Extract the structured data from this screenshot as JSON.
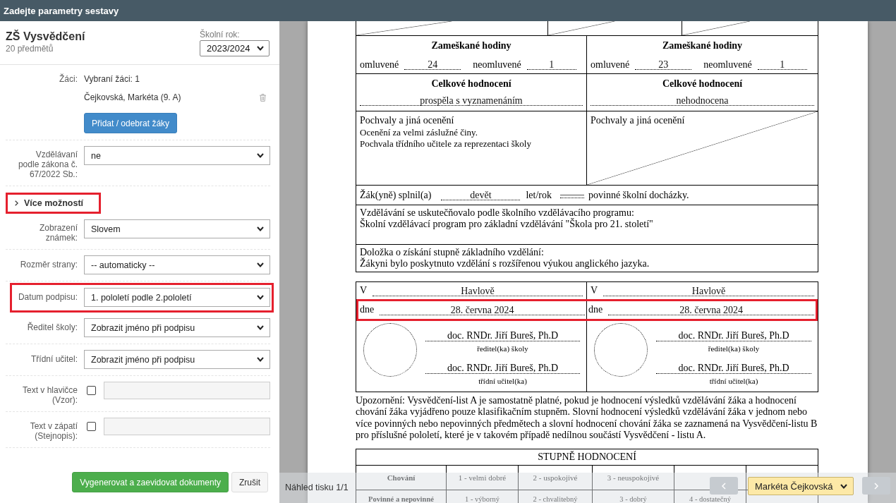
{
  "window": {
    "title": "Zadejte parametry sestavy"
  },
  "report": {
    "title": "ZŠ Vysvědčení",
    "subtitle": "20 předmětů",
    "school_year": {
      "label": "Školní rok:",
      "value": "2023/2024"
    }
  },
  "students": {
    "label": "Žáci:",
    "summary": "Vybraní žáci: 1",
    "items": [
      {
        "name": "Čejkovská, Markéta (9. A)"
      }
    ],
    "button": "Přidat / odebrat žáky"
  },
  "fields": [
    {
      "kind": "select",
      "label": "Vzdělávaní podle zákona č. 67/2022 Sb.:",
      "value": "ne",
      "highlighted": false
    },
    {
      "kind": "more_link",
      "label": "Více možností",
      "expanded": false,
      "highlighted": true
    },
    {
      "kind": "select",
      "label": "Zobrazení známek:",
      "value": "Slovem",
      "highlighted": false
    },
    {
      "kind": "select",
      "label": "Rozměr strany:",
      "value": "-- automaticky --",
      "highlighted": false
    },
    {
      "kind": "select",
      "label": "Datum podpisu:",
      "value": "1. pololetí podle 2.pololetí",
      "highlighted": true
    },
    {
      "kind": "select",
      "label": "Ředitel školy:",
      "value": "Zobrazit jméno při podpisu",
      "highlighted": false
    },
    {
      "kind": "select",
      "label": "Třídní učitel:",
      "value": "Zobrazit jméno při podpisu",
      "highlighted": false
    },
    {
      "kind": "check_text",
      "label": "Text v hlavičce (Vzor):",
      "checked": false
    },
    {
      "kind": "check_text",
      "label": "Text v zápatí (Stejnopis):",
      "checked": false
    }
  ],
  "actions": [
    {
      "kind": "primary",
      "label": "Vygenerovat a zaevidovat dokumenty"
    },
    {
      "kind": "secondary",
      "label": "Zrušit"
    }
  ],
  "document": {
    "top_row": [
      {
        "crossed_out": true
      },
      {
        "crossed_out": true
      },
      {
        "crossed_out": true
      }
    ],
    "semesters": [
      {
        "absence_title": "Zameškané hodiny",
        "excused_label": "omluvené",
        "excused": "24",
        "unexcused_label": "neomluvené",
        "unexcused": "1",
        "overall_title": "Celkové hodnocení",
        "overall": "prospěla s vyznamenáním",
        "praise_title": "Pochvaly a jiná ocenění",
        "praise": [
          "Ocenění za velmi záslužné činy.",
          "Pochvala třídního učitele za reprezentaci školy"
        ],
        "praise_crossed_out": false
      },
      {
        "absence_title": "Zameškané hodiny",
        "excused_label": "omluvené",
        "excused": "23",
        "unexcused_label": "neomluvené",
        "unexcused": "1",
        "overall_title": "Celkové hodnocení",
        "overall": "nehodnocena",
        "praise_title": "Pochvaly a jiná ocenění",
        "praise_crossed_out": true
      }
    ],
    "attendance": {
      "prefix": "Žák(yně) splnil(a)",
      "years": "devět",
      "unit": "let/rok",
      "blank_crossed_out": true,
      "suffix": "povinné školní docházky."
    },
    "program": {
      "heading": "Vzdělávání se uskutečňovalo podle školního vzdělávacího programu:",
      "text": "Školní vzdělávací program pro základní vzdělávání \"Škola pro 21. století\""
    },
    "clause": {
      "heading": "Doložka o získání stupně základního vzdělání:",
      "text": "Žákyni bylo poskytnuto vzdělání s rozšířenou výukou anglického jazyka."
    },
    "signatures": {
      "date_highlighted": true,
      "columns": [
        {
          "place_label": "V",
          "place": "Havlově",
          "date_label": "dne",
          "date": "28. června 2024",
          "principal": "doc. RNDr. Jiří Bureš, Ph.D",
          "principal_role": "ředitel(ka) školy",
          "teacher": "doc. RNDr. Jiří Bureš, Ph.D",
          "teacher_role": "třídní učitel(ka)"
        },
        {
          "place_label": "V",
          "place": "Havlově",
          "date_label": "dne",
          "date": "28. června 2024",
          "principal": "doc. RNDr. Jiří Bureš, Ph.D",
          "principal_role": "ředitel(ka) školy",
          "teacher": "doc. RNDr. Jiří Bureš, Ph.D",
          "teacher_role": "třídní učitel(ka)"
        }
      ]
    },
    "notice": "Upozornění: Vysvědčení-list A je samostatně platné, pokud je hodnocení výsledků vzdělávání žáka a hodnocení chování žáka vyjádřeno pouze klasifikačním stupněm. Slovní hodnocení výsledků vzdělávání žáka v jednom nebo více povinných nebo nepovinných předmětech a slovní hodnocení chování žáka se zaznamená na Vysvědčení-listu B pro příslušné pololetí, které je v takovém případě nedílnou součástí Vysvědčení - listu A.",
    "grades": {
      "title": "STUPNĚ HODNOCENÍ",
      "rows": [
        {
          "cells": [
            "Chování",
            "1 - velmi dobré",
            "2 - uspokojivé",
            "3 - neuspokojivé"
          ]
        },
        {
          "cells": [
            "Povinné a nepovinné",
            "1 - výborný",
            "2 - chvalitebný",
            "3 - dobrý",
            "4 - dostatečný"
          ]
        }
      ]
    }
  },
  "preview_bar": {
    "page_label": "Náhled tisku 1/1",
    "previous_disabled": true,
    "student": "Markéta Čejkovská",
    "next_disabled": true
  }
}
